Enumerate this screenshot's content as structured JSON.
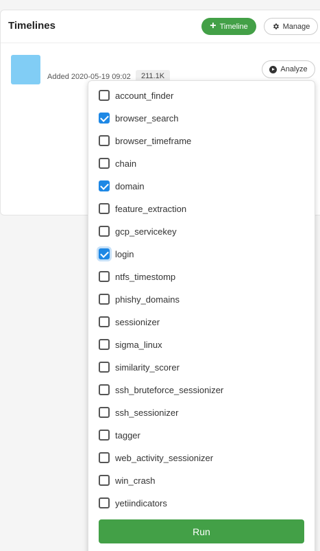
{
  "card": {
    "title": "Timelines",
    "add_timeline_label": "Timeline",
    "manage_label": "Manage",
    "timeline": {
      "added_text": "Added 2020-05-19 09:02",
      "size": "211.1K",
      "analyze_label": "Analyze",
      "thumb_color": "#81cdf5"
    }
  },
  "analyzers": {
    "options": [
      {
        "label": "account_finder",
        "checked": false
      },
      {
        "label": "browser_search",
        "checked": true
      },
      {
        "label": "browser_timeframe",
        "checked": false
      },
      {
        "label": "chain",
        "checked": false
      },
      {
        "label": "domain",
        "checked": true
      },
      {
        "label": "feature_extraction",
        "checked": false
      },
      {
        "label": "gcp_servicekey",
        "checked": false
      },
      {
        "label": "login",
        "checked": true
      },
      {
        "label": "ntfs_timestomp",
        "checked": false
      },
      {
        "label": "phishy_domains",
        "checked": false
      },
      {
        "label": "sessionizer",
        "checked": false
      },
      {
        "label": "sigma_linux",
        "checked": false
      },
      {
        "label": "similarity_scorer",
        "checked": false
      },
      {
        "label": "ssh_bruteforce_sessionizer",
        "checked": false
      },
      {
        "label": "ssh_sessionizer",
        "checked": false
      },
      {
        "label": "tagger",
        "checked": false
      },
      {
        "label": "web_activity_sessionizer",
        "checked": false
      },
      {
        "label": "win_crash",
        "checked": false
      },
      {
        "label": "yetiindicators",
        "checked": false
      }
    ],
    "run_label": "Run"
  },
  "colors": {
    "accent_green": "#43a047",
    "checkbox_blue": "#1e88e5"
  },
  "icons": {
    "add": "plus-icon",
    "manage": "gear-icon",
    "analyze": "play-circle-icon"
  }
}
